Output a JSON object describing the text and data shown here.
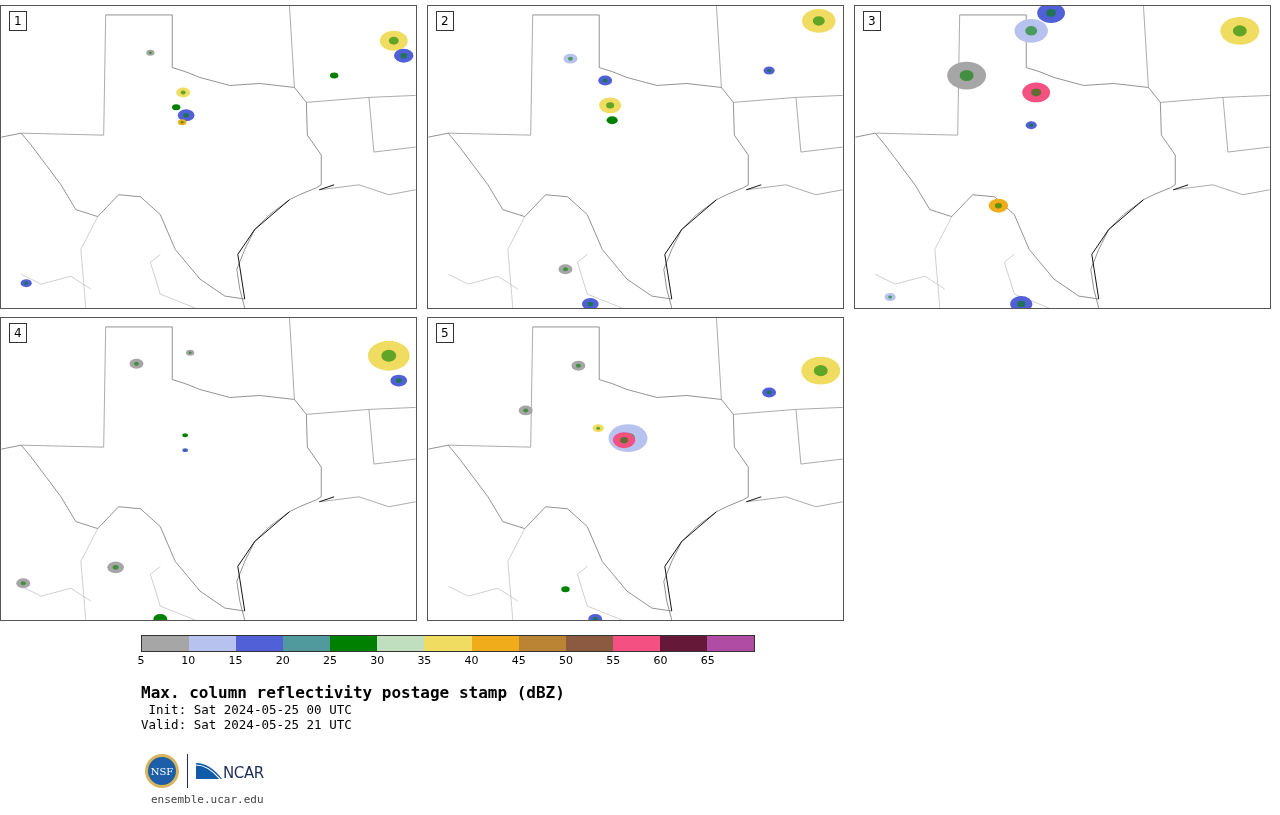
{
  "panels": [
    {
      "label": "1"
    },
    {
      "label": "2"
    },
    {
      "label": "3"
    },
    {
      "label": "4"
    },
    {
      "label": "5"
    }
  ],
  "colorbar": {
    "segments": [
      {
        "color": "#a6a6a6"
      },
      {
        "color": "#b8c2ee"
      },
      {
        "color": "#5160d6"
      },
      {
        "color": "#50999d"
      },
      {
        "color": "#008000"
      },
      {
        "color": "#c0dfbf"
      },
      {
        "color": "#f0dc60"
      },
      {
        "color": "#f0ac1a"
      },
      {
        "color": "#bb8434"
      },
      {
        "color": "#8b5a40"
      },
      {
        "color": "#f45082"
      },
      {
        "color": "#661838"
      },
      {
        "color": "#b04ca4"
      }
    ],
    "ticks": [
      "5",
      "10",
      "15",
      "20",
      "25",
      "30",
      "35",
      "40",
      "45",
      "50",
      "55",
      "60",
      "65"
    ]
  },
  "title": "Max. column reflectivity postage stamp (dBZ)",
  "init": " Init: Sat 2024-05-25 00 UTC",
  "valid": "Valid: Sat 2024-05-25 21 UTC",
  "logos": {
    "nsf": "NSF",
    "ncar": "NCAR"
  },
  "url": "ensemble.ucar.edu"
}
